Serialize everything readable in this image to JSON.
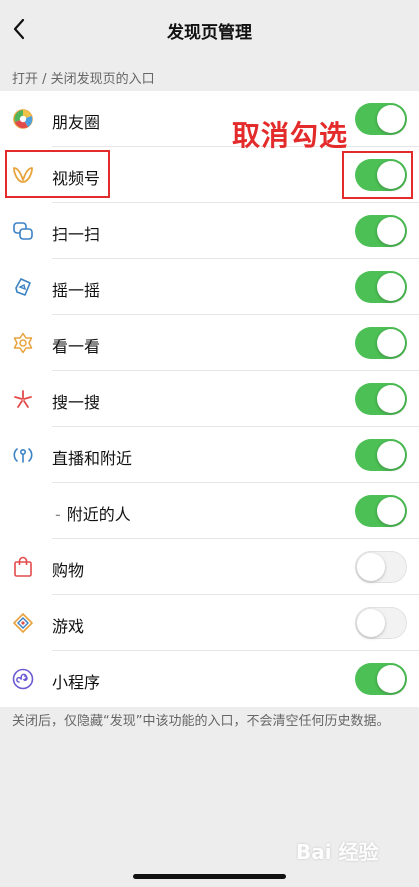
{
  "header": {
    "title": "发现页管理"
  },
  "section_label": "打开 / 关闭发现页的入口",
  "items": [
    {
      "label": "朋友圈",
      "icon": "moments-icon",
      "enabled": true
    },
    {
      "label": "视频号",
      "icon": "channels-icon",
      "enabled": true
    },
    {
      "label": "扫一扫",
      "icon": "scan-icon",
      "enabled": true
    },
    {
      "label": "摇一摇",
      "icon": "shake-icon",
      "enabled": true
    },
    {
      "label": "看一看",
      "icon": "top-stories-icon",
      "enabled": true
    },
    {
      "label": "搜一搜",
      "icon": "search-icon",
      "enabled": true
    },
    {
      "label": "直播和附近",
      "icon": "live-nearby-icon",
      "enabled": true
    },
    {
      "label": "附近的人",
      "icon": "",
      "enabled": true,
      "sub": true
    },
    {
      "label": "购物",
      "icon": "shopping-icon",
      "enabled": false
    },
    {
      "label": "游戏",
      "icon": "games-icon",
      "enabled": false
    },
    {
      "label": "小程序",
      "icon": "mini-programs-icon",
      "enabled": true
    }
  ],
  "annotation": "取消勾选",
  "footer_note": "关闭后，仅隐藏“发现”中该功能的入口，不会清空任何历史数据。",
  "watermark": "Bai 经验",
  "colors": {
    "accent": "#4cbf55",
    "annotation": "#e32b2b"
  }
}
